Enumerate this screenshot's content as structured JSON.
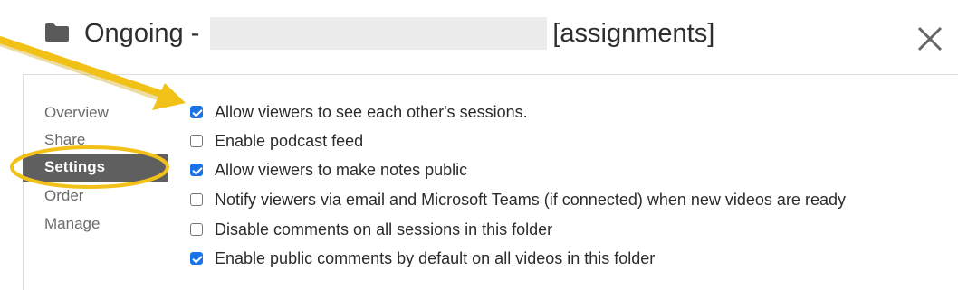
{
  "header": {
    "title_prefix": "Ongoing -",
    "title_suffix": "[assignments]",
    "folder_icon": "folder-icon",
    "close_icon": "close-icon"
  },
  "nav": {
    "items": [
      {
        "label": "Overview",
        "active": false
      },
      {
        "label": "Share",
        "active": false
      },
      {
        "label": "Settings",
        "active": true
      },
      {
        "label": "Order",
        "active": false
      },
      {
        "label": "Manage",
        "active": false
      }
    ]
  },
  "settings": {
    "options": [
      {
        "label": "Allow viewers to see each other's sessions.",
        "checked": true
      },
      {
        "label": "Enable podcast feed",
        "checked": false
      },
      {
        "label": "Allow viewers to make notes public",
        "checked": true
      },
      {
        "label": "Notify viewers via email and Microsoft Teams (if connected) when new videos are ready",
        "checked": false
      },
      {
        "label": "Disable comments on all sessions in this folder",
        "checked": false
      },
      {
        "label": "Enable public comments by default on all videos in this folder",
        "checked": true
      }
    ]
  },
  "annotations": {
    "color": "#f2c118",
    "arrow": "pointer-arrow",
    "ellipse": "highlight-ellipse"
  }
}
